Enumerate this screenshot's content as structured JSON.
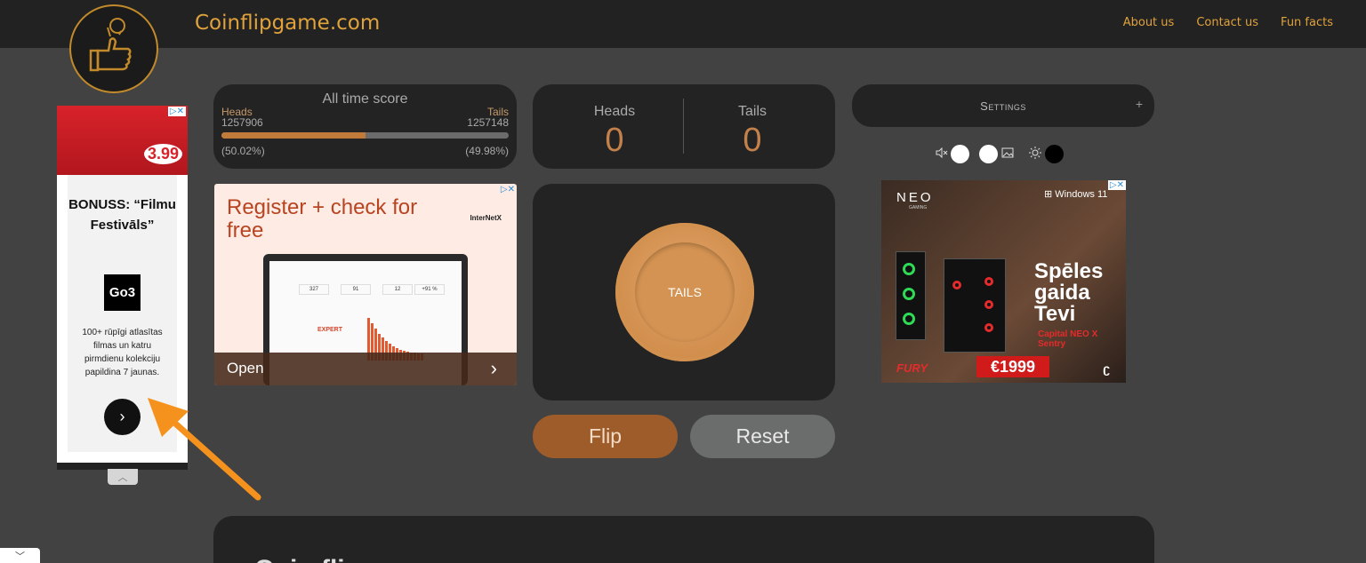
{
  "header": {
    "site_title": "Coinflipgame.com",
    "nav": [
      "About us",
      "Contact us",
      "Fun facts"
    ]
  },
  "score": {
    "title": "All time score",
    "heads_label": "Heads",
    "tails_label": "Tails",
    "heads_count": "1257906",
    "tails_count": "1257148",
    "heads_pct": "(50.02%)",
    "tails_pct": "(49.98%)",
    "heads_fraction": 0.5002
  },
  "session": {
    "heads_label": "Heads",
    "tails_label": "Tails",
    "heads_value": "0",
    "tails_value": "0"
  },
  "settings": {
    "label": "Settings",
    "toggle_icon": "+"
  },
  "coin": {
    "face": "TAILS"
  },
  "buttons": {
    "flip": "Flip",
    "reset": "Reset"
  },
  "bottom": {
    "peek_text": "Coin fli"
  },
  "ads": {
    "left": {
      "price": "3.99",
      "headline": "BONUSS: “Filmu Festivāls”",
      "logo": "Go3",
      "description": "100+ rūpīgi atlasītas filmas un katru pirmdienu kolekciju papildina 7 jaunas."
    },
    "middle": {
      "headline": "Register + check for free",
      "brand": "InterNetX",
      "cta": "Open",
      "stats": [
        "327",
        "91",
        "12",
        "+91 %"
      ],
      "badge": "EXPERT"
    },
    "right": {
      "brand": "NEO",
      "brand_sub": "GAMING",
      "windows": "Windows 11",
      "headline": "Spēles gaida Tevi",
      "model": "Capital NEO X Sentry",
      "price": "€1999",
      "fury": "FURY"
    }
  },
  "colors": {
    "accent": "#e0a23c",
    "panel": "#232323",
    "background": "#424242",
    "flip_button": "#9d5c2a",
    "reset_button": "#6a6d6b",
    "annotation_arrow": "#f5921e"
  }
}
